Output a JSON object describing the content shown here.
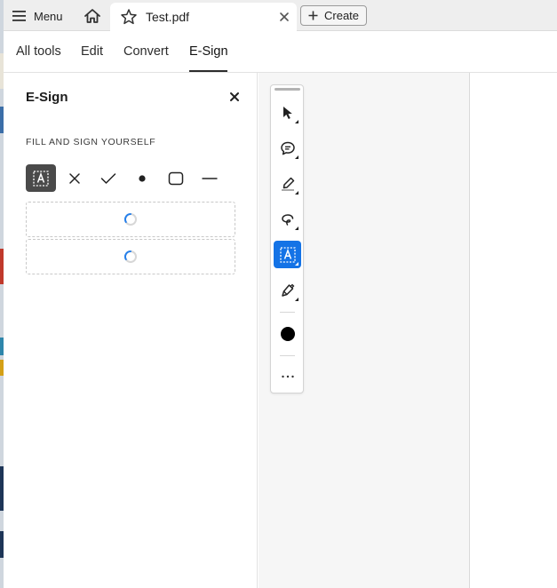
{
  "app": {
    "menu_label": "Menu",
    "document_tab_title": "Test.pdf",
    "create_label": "Create"
  },
  "toolnav": {
    "tabs": [
      {
        "label": "All tools"
      },
      {
        "label": "Edit"
      },
      {
        "label": "Convert"
      },
      {
        "label": "E-Sign",
        "active": true
      }
    ]
  },
  "esign_panel": {
    "title": "E-Sign",
    "section_label": "FILL AND SIGN YOURSELF",
    "tools": [
      {
        "icon": "add-text-icon",
        "selected": true
      },
      {
        "icon": "cross-mark-icon"
      },
      {
        "icon": "checkmark-icon"
      },
      {
        "icon": "dot-icon"
      },
      {
        "icon": "rounded-rectangle-icon"
      },
      {
        "icon": "line-icon"
      }
    ],
    "signature_slots": [
      {
        "state": "loading"
      },
      {
        "state": "loading"
      }
    ]
  },
  "quick_toolbar": {
    "tools": [
      {
        "icon": "select-cursor-icon"
      },
      {
        "icon": "comment-icon"
      },
      {
        "icon": "highlighter-icon"
      },
      {
        "icon": "lasso-draw-icon"
      },
      {
        "icon": "add-text-icon",
        "selected": true
      },
      {
        "icon": "pen-sign-icon"
      }
    ],
    "color_icon": "color-swatch-icon",
    "more_icon": "more-options-icon"
  },
  "colors": {
    "accent": "#1473e6",
    "selected_tool_bg": "#4a4a4a",
    "spinner": "#2680eb",
    "tabbar_bg": "#eeeeee",
    "doc_bg": "#f6f6f6"
  }
}
